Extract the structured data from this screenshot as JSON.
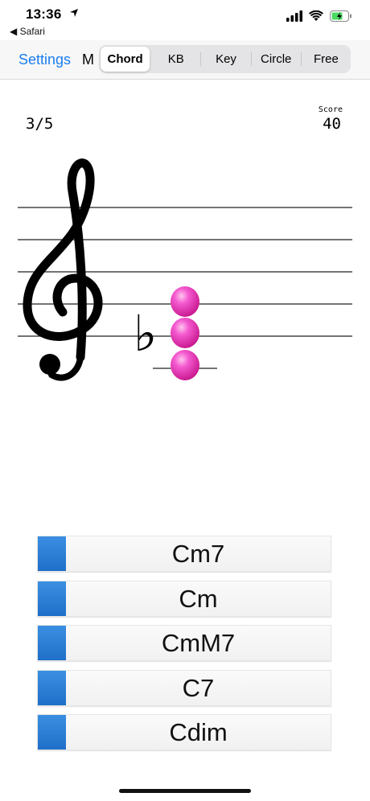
{
  "status_bar": {
    "time": "13:36",
    "location_icon": "location-arrow-icon",
    "back_app": "◀ Safari",
    "icons": [
      "signal-icon",
      "wifi-icon",
      "battery-charging-icon"
    ],
    "battery_color": "#4cd964"
  },
  "nav": {
    "settings_label": "Settings",
    "truncated_label": "M",
    "accent_color": "#1a7ef0",
    "segments": [
      {
        "label": "Chord",
        "selected": true
      },
      {
        "label": "KB",
        "selected": false
      },
      {
        "label": "Key",
        "selected": false
      },
      {
        "label": "Circle",
        "selected": false
      },
      {
        "label": "Free",
        "selected": false
      }
    ]
  },
  "quiz": {
    "progress": "3/5",
    "score_label": "Score",
    "score_value": "40",
    "clef_icon": "treble-clef-icon",
    "accidental_symbol": "♭",
    "note_color": "#f03cc0",
    "answers": [
      "Cm7",
      "Cm",
      "CmM7",
      "C7",
      "Cdim"
    ],
    "answer_tab_color": "#2a7fd8"
  }
}
